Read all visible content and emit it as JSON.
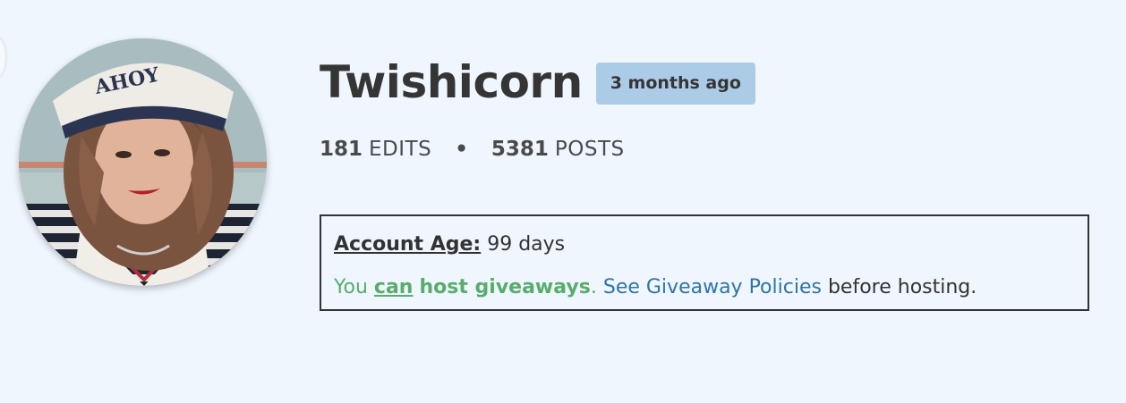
{
  "profile": {
    "username": "Twishicorn",
    "joined_badge": "3 months ago",
    "avatar_alt": "profile picture",
    "stats": {
      "edits_count": "181",
      "edits_label": "EDITS",
      "separator": "•",
      "posts_count": "5381",
      "posts_label": "POSTS"
    }
  },
  "account_info": {
    "age_label": "Account Age:",
    "age_value": "99 days",
    "host_prefix": "You",
    "host_can": "can",
    "host_text": "host giveaways",
    "host_period": ".",
    "policy_link": "See Giveaway Policies",
    "host_suffix": "before hosting."
  },
  "colors": {
    "background": "#eff6fe",
    "badge": "#abcbe6",
    "success": "#59ad6b",
    "link": "#2f74a8",
    "text": "#333333"
  }
}
